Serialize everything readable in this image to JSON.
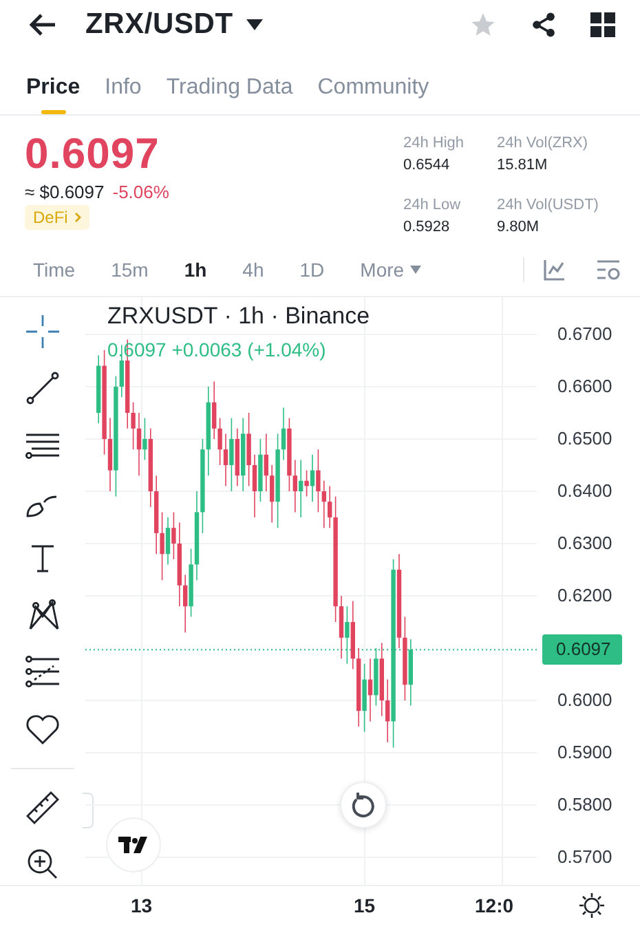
{
  "header": {
    "title": "ZRX/USDT"
  },
  "tabs": [
    {
      "label": "Price",
      "selected": true
    },
    {
      "label": "Info",
      "selected": false
    },
    {
      "label": "Trading Data",
      "selected": false
    },
    {
      "label": "Community",
      "selected": false
    }
  ],
  "price": {
    "last": "0.6097",
    "fiat": "≈ $0.6097",
    "change": "-5.06%",
    "tag": "DeFi"
  },
  "stats": [
    {
      "label": "24h High",
      "value": "0.6544"
    },
    {
      "label": "24h Vol(ZRX)",
      "value": "15.81M"
    },
    {
      "label": "24h Low",
      "value": "0.5928"
    },
    {
      "label": "24h Vol(USDT)",
      "value": "9.80M"
    }
  ],
  "intervals": [
    {
      "label": "Time",
      "selected": false
    },
    {
      "label": "15m",
      "selected": false
    },
    {
      "label": "1h",
      "selected": true
    },
    {
      "label": "4h",
      "selected": false
    },
    {
      "label": "1D",
      "selected": false
    },
    {
      "label": "More",
      "selected": false
    }
  ],
  "tools": [
    {
      "kind": "crosshair",
      "selected": true
    },
    {
      "kind": "line",
      "selected": false
    },
    {
      "kind": "lines",
      "selected": false
    },
    {
      "kind": "brush",
      "selected": false
    },
    {
      "kind": "text",
      "selected": false
    },
    {
      "kind": "pattern",
      "selected": false
    },
    {
      "kind": "fib",
      "selected": false
    },
    {
      "kind": "heart",
      "selected": false
    },
    {
      "kind": "ruler",
      "selected": false
    }
  ],
  "chart": {
    "title": "ZRXUSDT · 1h · Binance",
    "quote": "0.6097 +0.0063 (+1.04%)",
    "price_axis": [
      "0.6700",
      "0.6600",
      "0.6500",
      "0.6400",
      "0.6300",
      "0.6200",
      "0.6000",
      "0.5900",
      "0.5800",
      "0.5700"
    ],
    "current_price": "0.6097",
    "time_axis": [
      "13",
      "15",
      "12:0"
    ]
  }
}
